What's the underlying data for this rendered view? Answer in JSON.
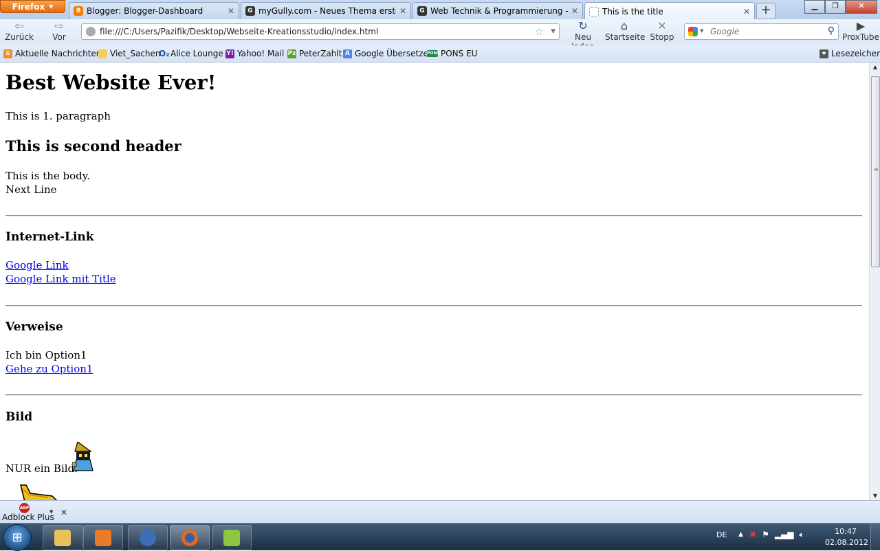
{
  "window": {
    "menu_button_label": "Firefox",
    "minimize_icon": "minimize-icon",
    "maximize_icon": "maximize-icon",
    "close_icon": "close-icon"
  },
  "tabs": [
    {
      "title": "Blogger: Blogger-Dashboard",
      "icon": "blogger-icon",
      "icon_color": "#f57d00",
      "active": false
    },
    {
      "title": "myGully.com - Neues Thema erstellen",
      "icon": "gully-icon",
      "icon_color": "#333333",
      "active": false
    },
    {
      "title": "Web Technik & Programmierung - m...",
      "icon": "gully-icon",
      "icon_color": "#333333",
      "active": false
    },
    {
      "title": "This is the title",
      "icon": "blank-page-icon",
      "icon_color": "#ffffff",
      "active": true
    }
  ],
  "toolbar": {
    "back_label": "Zurück",
    "forward_label": "Vor",
    "url": "file:///C:/Users/Pazifik/Desktop/Webseite-Kreationsstudio/index.html",
    "reload_label": "Neu laden",
    "home_label": "Startseite",
    "stop_label": "Stopp",
    "search_placeholder": "Google",
    "proxtube_label": "ProxTube"
  },
  "bookmarks": {
    "items": [
      {
        "label": "Aktuelle Nachrichten",
        "icon": "rss-feed-icon"
      },
      {
        "label": "Viet_Sachen",
        "icon": "folder-icon"
      },
      {
        "label": "Alice Lounge",
        "icon": "o2-icon"
      },
      {
        "label": "Yahoo! Mail",
        "icon": "yahoo-icon"
      },
      {
        "label": "PeterZahlt",
        "icon": "peterzahlt-icon"
      },
      {
        "label": "Google Übersetzer",
        "icon": "google-translate-icon"
      },
      {
        "label": "PONS EU",
        "icon": "pons-icon"
      }
    ],
    "reading_list_label": "Lesezeichen"
  },
  "page": {
    "h1": "Best Website Ever!",
    "p1": "This is 1. paragraph",
    "h2": "This is second header",
    "body_line1": "This is the body.",
    "body_line2": "Next Line",
    "section_links_title": "Internet-Link",
    "link1": "Google Link",
    "link2": "Google Link mit Title",
    "section_refs_title": "Verweise",
    "option_text": "Ich bin Option1",
    "option_link": "Gehe zu Option1",
    "section_image_title": "Bild",
    "image_caption": "NUR ein Bild:"
  },
  "addon_bar": {
    "adblock_label": "Adblock Plus",
    "adblock_icon_text": "ABP"
  },
  "taskbar": {
    "language": "DE",
    "time": "10:47",
    "date": "02.08.2012",
    "pinned": [
      {
        "name": "explorer-icon",
        "color": "#e9c15a"
      },
      {
        "name": "media-player-icon",
        "color": "#e87c2a"
      },
      {
        "name": "thunderbird-icon",
        "color": "#3c6fb5"
      },
      {
        "name": "firefox-icon",
        "color": "#e56a1f",
        "active": true
      },
      {
        "name": "notepad-plus-icon",
        "color": "#8ec63f"
      }
    ]
  }
}
